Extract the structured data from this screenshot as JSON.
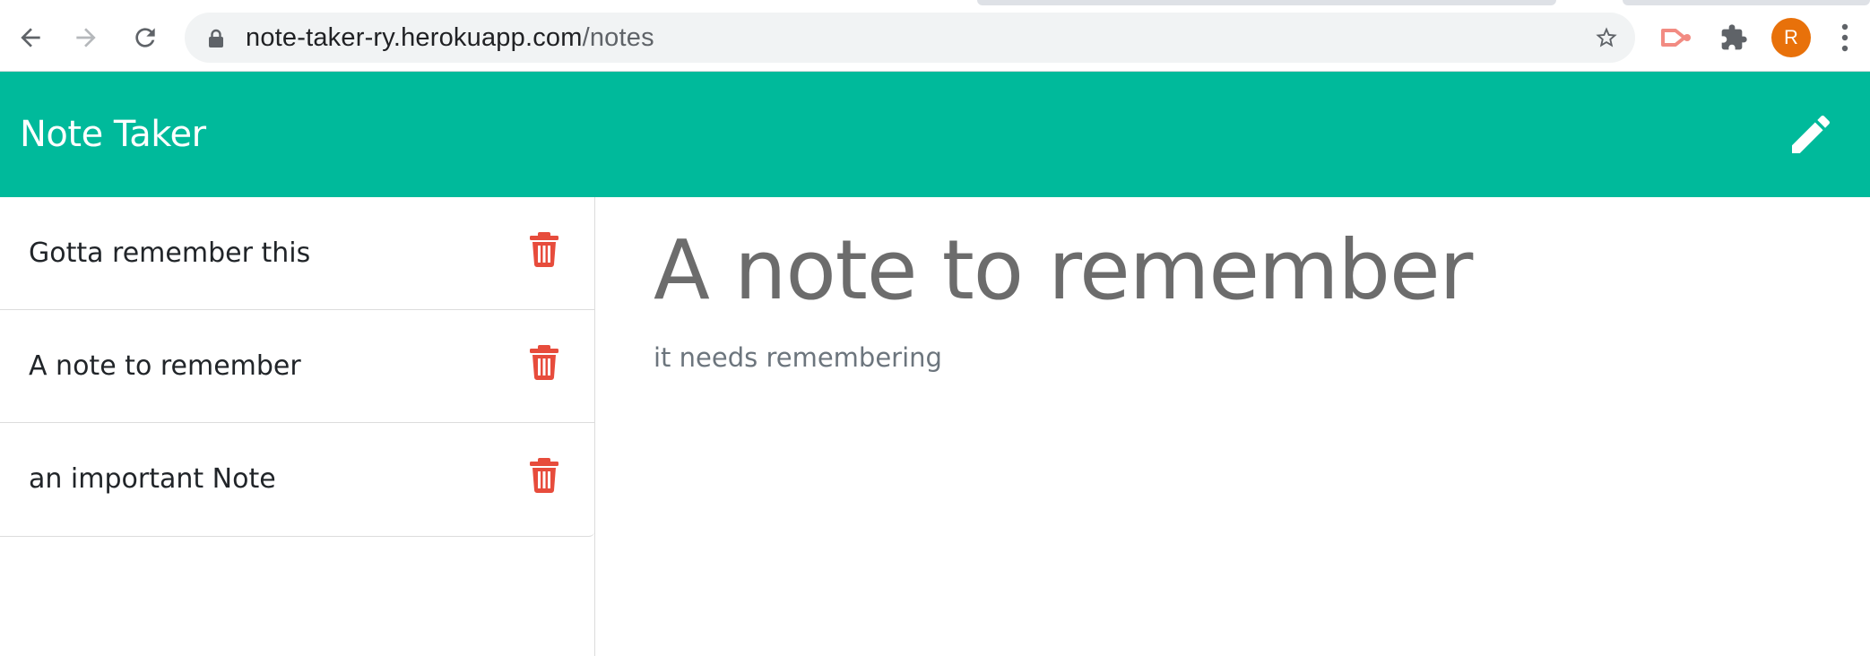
{
  "browser": {
    "url_host": "note-taker-ry.herokuapp.com",
    "url_path": "/notes",
    "profile_initial": "R",
    "profile_color": "#e8710a"
  },
  "app": {
    "brand": "Note Taker",
    "header_color": "#00ba9b",
    "new_note_icon": "pencil-icon"
  },
  "notes": [
    {
      "title": "Gotta remember this",
      "delete_icon": "trash-icon"
    },
    {
      "title": "A note to remember",
      "delete_icon": "trash-icon"
    },
    {
      "title": "an important Note",
      "delete_icon": "trash-icon"
    }
  ],
  "active_note": {
    "title": "A note to remember",
    "text": "it needs remembering"
  },
  "colors": {
    "delete": "#e74c3c"
  }
}
